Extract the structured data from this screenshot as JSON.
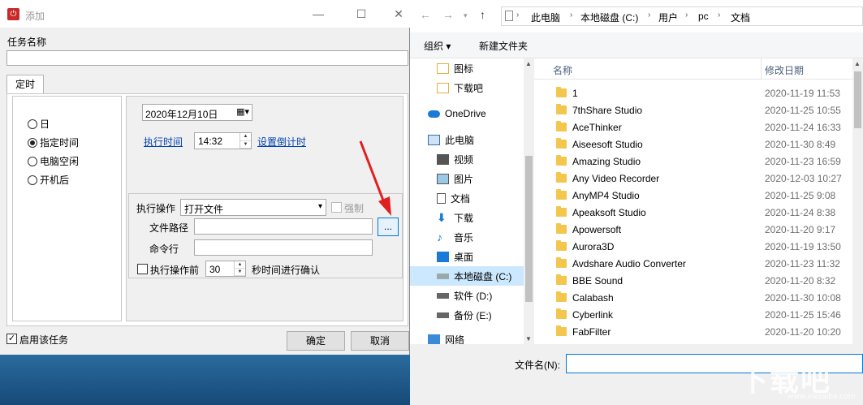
{
  "dialog": {
    "title": "添加",
    "task_name_label": "任务名称",
    "task_name_value": "",
    "tab_label": "定时",
    "radios": [
      {
        "label": "日",
        "selected": false
      },
      {
        "label": "指定时间",
        "selected": true
      },
      {
        "label": "电脑空闲",
        "selected": false
      },
      {
        "label": "开机后",
        "selected": false
      }
    ],
    "date_value": "2020年12月10日",
    "exec_time_link": "执行时间",
    "exec_time_value": "14:32",
    "countdown_link": "设置倒计时",
    "action_label": "执行操作",
    "action_value": "打开文件",
    "force_label": "强制",
    "file_path_label": "文件路径",
    "file_path_value": "",
    "browse_label": "...",
    "cmdline_label": "命令行",
    "cmdline_value": "",
    "pre_exec_label": "执行操作前",
    "pre_exec_seconds": "30",
    "confirm_suffix": "秒时间进行确认",
    "enable_label": "启用该任务",
    "ok_label": "确定",
    "cancel_label": "取消"
  },
  "file_dialog": {
    "breadcrumb": [
      "此电脑",
      "本地磁盘 (C:)",
      "用户",
      "pc",
      "文档"
    ],
    "organize_label": "组织 ▾",
    "new_folder_label": "新建文件夹",
    "nav": [
      {
        "label": "图标",
        "icon": "folder-icon"
      },
      {
        "label": "下载吧",
        "icon": "folder-icon"
      },
      {
        "label": "OneDrive",
        "icon": "cloud-icon"
      },
      {
        "label": "此电脑",
        "icon": "computer-icon"
      },
      {
        "label": "视频",
        "icon": "video-icon"
      },
      {
        "label": "图片",
        "icon": "picture-icon"
      },
      {
        "label": "文档",
        "icon": "document-icon"
      },
      {
        "label": "下载",
        "icon": "download-icon"
      },
      {
        "label": "音乐",
        "icon": "music-icon"
      },
      {
        "label": "桌面",
        "icon": "desktop-icon"
      },
      {
        "label": "本地磁盘 (C:)",
        "icon": "drive-icon"
      },
      {
        "label": "软件 (D:)",
        "icon": "drive-icon"
      },
      {
        "label": "备份 (E:)",
        "icon": "drive-icon"
      },
      {
        "label": "网络",
        "icon": "network-icon"
      }
    ],
    "columns": {
      "name": "名称",
      "modified": "修改日期"
    },
    "files": [
      {
        "name": "1",
        "date": "2020-11-19 11:53"
      },
      {
        "name": "7thShare Studio",
        "date": "2020-11-25 10:55"
      },
      {
        "name": "AceThinker",
        "date": "2020-11-24 16:33"
      },
      {
        "name": "Aiseesoft Studio",
        "date": "2020-11-30 8:49"
      },
      {
        "name": "Amazing Studio",
        "date": "2020-11-23 16:59"
      },
      {
        "name": "Any Video Recorder",
        "date": "2020-12-03 10:27"
      },
      {
        "name": "AnyMP4 Studio",
        "date": "2020-11-25 9:08"
      },
      {
        "name": "Apeaksoft Studio",
        "date": "2020-11-24 8:38"
      },
      {
        "name": "Apowersoft",
        "date": "2020-11-20 9:17"
      },
      {
        "name": "Aurora3D",
        "date": "2020-11-19 13:50"
      },
      {
        "name": "Avdshare Audio Converter",
        "date": "2020-11-23 11:32"
      },
      {
        "name": "BBE Sound",
        "date": "2020-11-20 8:32"
      },
      {
        "name": "Calabash",
        "date": "2020-11-30 10:08"
      },
      {
        "name": "Cyberlink",
        "date": "2020-11-25 15:46"
      },
      {
        "name": "FabFilter",
        "date": "2020-11-20 10:20"
      }
    ],
    "filename_label": "文件名(N):",
    "filename_value": ""
  },
  "watermark": {
    "main": "下载吧",
    "sub": "www.xiazaiba.com"
  },
  "colors": {
    "accent": "#0078d7",
    "selected_bg": "#cce8ff",
    "folder": "#f3c64d",
    "arrow": "#e02020"
  }
}
